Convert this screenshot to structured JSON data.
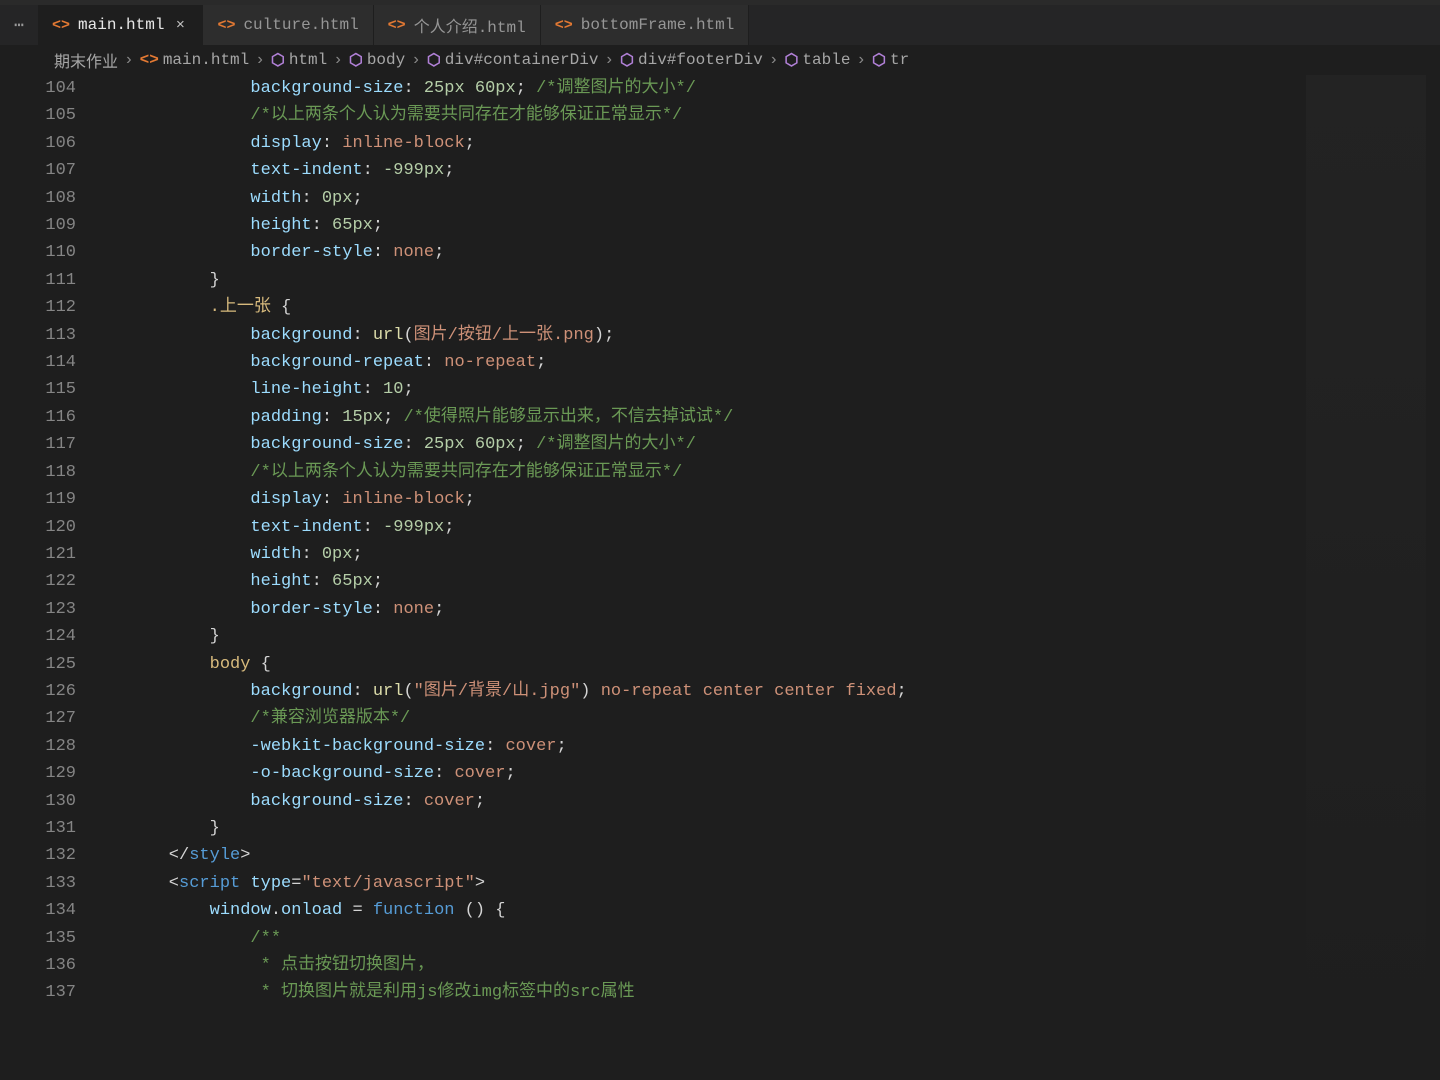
{
  "tabs": [
    {
      "label": "main.html",
      "active": true,
      "close": true
    },
    {
      "label": "culture.html",
      "active": false,
      "close": false
    },
    {
      "label": "个人介绍.html",
      "active": false,
      "close": false
    },
    {
      "label": "bottomFrame.html",
      "active": false,
      "close": false
    }
  ],
  "breadcrumbs": [
    {
      "icon": "",
      "text": "期末作业"
    },
    {
      "icon": "file",
      "text": "main.html"
    },
    {
      "icon": "cube",
      "text": "html"
    },
    {
      "icon": "cube",
      "text": "body"
    },
    {
      "icon": "cube",
      "text": "div#containerDiv"
    },
    {
      "icon": "cube",
      "text": "div#footerDiv"
    },
    {
      "icon": "cube",
      "text": "table"
    },
    {
      "icon": "cube",
      "text": "tr"
    }
  ],
  "gutterStart": 104,
  "lines": [
    [
      [
        "prop",
        "            background-size"
      ],
      [
        "punc",
        ": "
      ],
      [
        "num",
        "25px 60px"
      ],
      [
        "punc",
        "; "
      ],
      [
        "comment",
        "/*调整图片的大小*/"
      ]
    ],
    [
      [
        "comment",
        "            /*以上两条个人认为需要共同存在才能够保证正常显示*/"
      ]
    ],
    [
      [
        "prop",
        "            display"
      ],
      [
        "punc",
        ": "
      ],
      [
        "val",
        "inline-block"
      ],
      [
        "punc",
        ";"
      ]
    ],
    [
      [
        "prop",
        "            text-indent"
      ],
      [
        "punc",
        ": "
      ],
      [
        "num",
        "-999px"
      ],
      [
        "punc",
        ";"
      ]
    ],
    [
      [
        "prop",
        "            width"
      ],
      [
        "punc",
        ": "
      ],
      [
        "num",
        "0px"
      ],
      [
        "punc",
        ";"
      ]
    ],
    [
      [
        "prop",
        "            height"
      ],
      [
        "punc",
        ": "
      ],
      [
        "num",
        "65px"
      ],
      [
        "punc",
        ";"
      ]
    ],
    [
      [
        "prop",
        "            border-style"
      ],
      [
        "punc",
        ": "
      ],
      [
        "val",
        "none"
      ],
      [
        "punc",
        ";"
      ]
    ],
    [
      [
        "punc",
        "        }"
      ]
    ],
    [
      [
        "sel",
        "        .上一张 "
      ],
      [
        "punc",
        "{"
      ]
    ],
    [
      [
        "prop",
        "            background"
      ],
      [
        "punc",
        ": "
      ],
      [
        "func",
        "url"
      ],
      [
        "punc",
        "("
      ],
      [
        "val",
        "图片/按钮/上一张.png"
      ],
      [
        "punc",
        ");"
      ]
    ],
    [
      [
        "prop",
        "            background-repeat"
      ],
      [
        "punc",
        ": "
      ],
      [
        "val",
        "no-repeat"
      ],
      [
        "punc",
        ";"
      ]
    ],
    [
      [
        "prop",
        "            line-height"
      ],
      [
        "punc",
        ": "
      ],
      [
        "num",
        "10"
      ],
      [
        "punc",
        ";"
      ]
    ],
    [
      [
        "prop",
        "            padding"
      ],
      [
        "punc",
        ": "
      ],
      [
        "num",
        "15px"
      ],
      [
        "punc",
        "; "
      ],
      [
        "comment",
        "/*使得照片能够显示出来，不信去掉试试*/"
      ]
    ],
    [
      [
        "prop",
        "            background-size"
      ],
      [
        "punc",
        ": "
      ],
      [
        "num",
        "25px 60px"
      ],
      [
        "punc",
        "; "
      ],
      [
        "comment",
        "/*调整图片的大小*/"
      ]
    ],
    [
      [
        "comment",
        "            /*以上两条个人认为需要共同存在才能够保证正常显示*/"
      ]
    ],
    [
      [
        "prop",
        "            display"
      ],
      [
        "punc",
        ": "
      ],
      [
        "val",
        "inline-block"
      ],
      [
        "punc",
        ";"
      ]
    ],
    [
      [
        "prop",
        "            text-indent"
      ],
      [
        "punc",
        ": "
      ],
      [
        "num",
        "-999px"
      ],
      [
        "punc",
        ";"
      ]
    ],
    [
      [
        "prop",
        "            width"
      ],
      [
        "punc",
        ": "
      ],
      [
        "num",
        "0px"
      ],
      [
        "punc",
        ";"
      ]
    ],
    [
      [
        "prop",
        "            height"
      ],
      [
        "punc",
        ": "
      ],
      [
        "num",
        "65px"
      ],
      [
        "punc",
        ";"
      ]
    ],
    [
      [
        "prop",
        "            border-style"
      ],
      [
        "punc",
        ": "
      ],
      [
        "val",
        "none"
      ],
      [
        "punc",
        ";"
      ]
    ],
    [
      [
        "punc",
        "        }"
      ]
    ],
    [
      [
        "sel",
        "        body "
      ],
      [
        "punc",
        "{"
      ]
    ],
    [
      [
        "prop",
        "            background"
      ],
      [
        "punc",
        ": "
      ],
      [
        "func",
        "url"
      ],
      [
        "punc",
        "("
      ],
      [
        "str",
        "\"图片/背景/山.jpg\""
      ],
      [
        "punc",
        ") "
      ],
      [
        "val",
        "no-repeat center center fixed"
      ],
      [
        "punc",
        ";"
      ]
    ],
    [
      [
        "comment",
        "            /*兼容浏览器版本*/"
      ]
    ],
    [
      [
        "prop",
        "            -webkit-background-size"
      ],
      [
        "punc",
        ": "
      ],
      [
        "val",
        "cover"
      ],
      [
        "punc",
        ";"
      ]
    ],
    [
      [
        "prop",
        "            -o-background-size"
      ],
      [
        "punc",
        ": "
      ],
      [
        "val",
        "cover"
      ],
      [
        "punc",
        ";"
      ]
    ],
    [
      [
        "prop",
        "            background-size"
      ],
      [
        "punc",
        ": "
      ],
      [
        "val",
        "cover"
      ],
      [
        "punc",
        ";"
      ]
    ],
    [
      [
        "punc",
        "        }"
      ]
    ],
    [
      [
        "punc",
        "    </"
      ],
      [
        "tag",
        "style"
      ],
      [
        "punc",
        ">"
      ]
    ],
    [
      [
        "punc",
        "    <"
      ],
      [
        "tag",
        "script "
      ],
      [
        "attr",
        "type"
      ],
      [
        "punc",
        "="
      ],
      [
        "str",
        "\"text/javascript\""
      ],
      [
        "punc",
        ">"
      ]
    ],
    [
      [
        "ident",
        "        window"
      ],
      [
        "punc",
        "."
      ],
      [
        "ident",
        "onload"
      ],
      [
        "punc",
        " = "
      ],
      [
        "kw",
        "function"
      ],
      [
        "punc",
        " () {"
      ]
    ],
    [
      [
        "comment",
        "            /**"
      ]
    ],
    [
      [
        "comment",
        "             * 点击按钮切换图片，"
      ]
    ],
    [
      [
        "comment",
        "             * 切换图片就是利用js修改img标签中的src属性"
      ]
    ]
  ]
}
